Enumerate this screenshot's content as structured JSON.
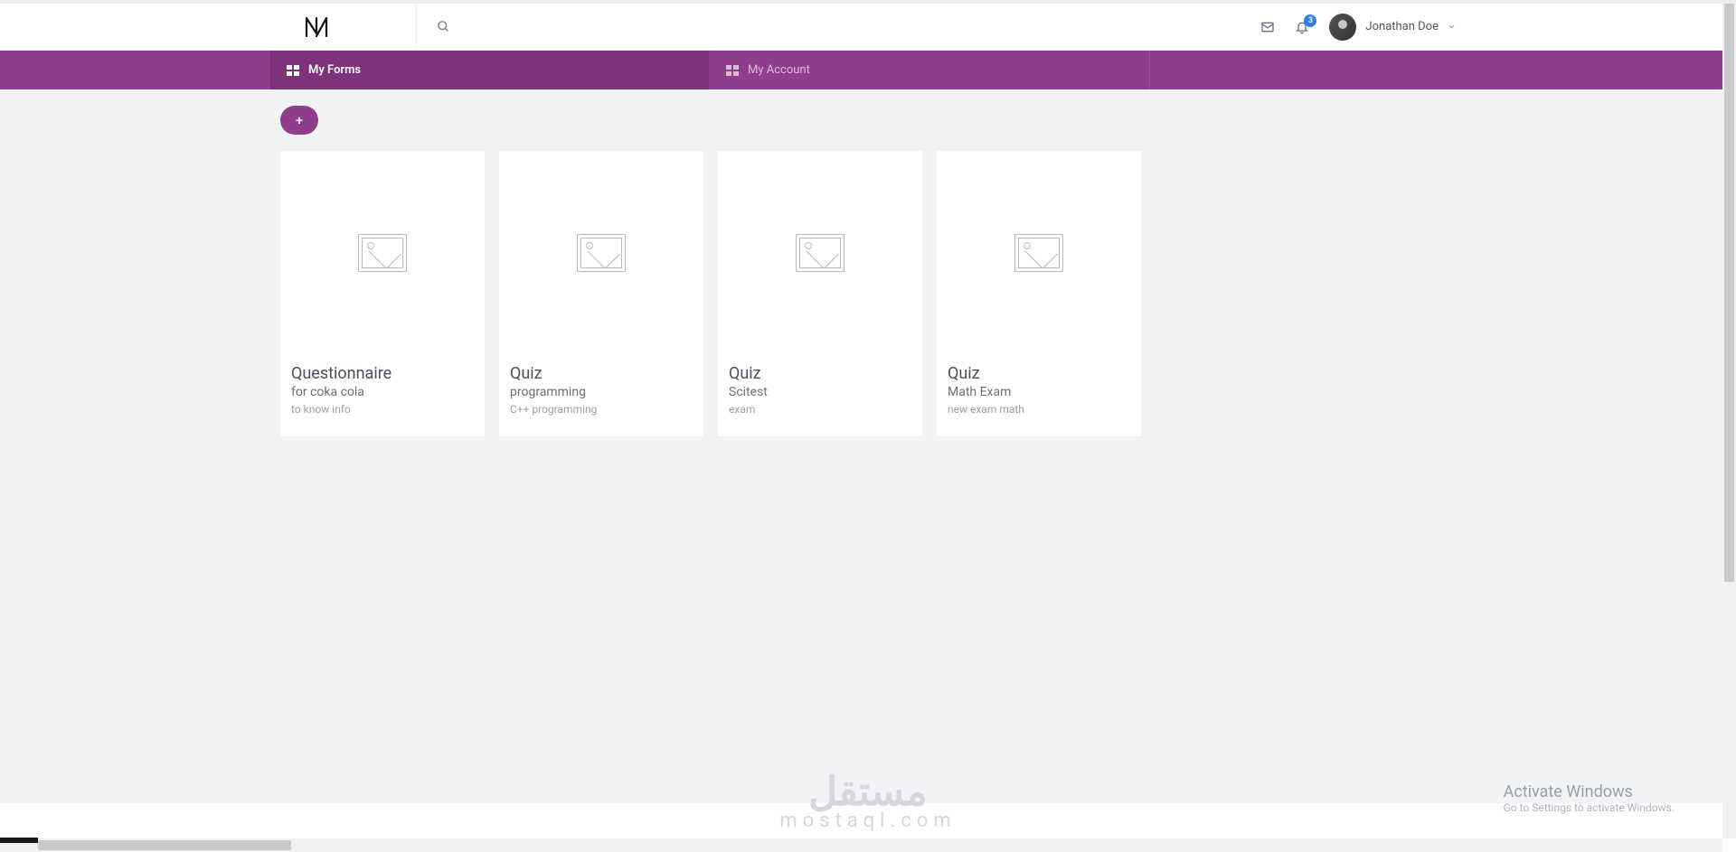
{
  "header": {
    "logo": "N",
    "notification_count": "3",
    "user_name": "Jonathan Doe"
  },
  "nav": {
    "my_forms": "My Forms",
    "my_account": "My Account"
  },
  "add_button": "+",
  "cards": [
    {
      "type": "Questionnaire",
      "title": "for coka cola",
      "desc": "to know info"
    },
    {
      "type": "Quiz",
      "title": "programming",
      "desc": "C++ programming"
    },
    {
      "type": "Quiz",
      "title": "Scitest",
      "desc": "exam"
    },
    {
      "type": "Quiz",
      "title": "Math Exam",
      "desc": "new exam math"
    }
  ],
  "watermark": {
    "big": "مستقل",
    "small": "mostaql.com"
  },
  "activate": {
    "title": "Activate Windows",
    "sub": "Go to Settings to activate Windows."
  }
}
